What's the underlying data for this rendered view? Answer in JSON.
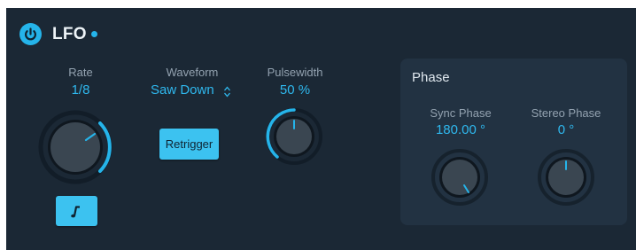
{
  "header": {
    "title": "LFO",
    "power_icon": "power-icon"
  },
  "rate": {
    "label": "Rate",
    "value": "1/8",
    "sync_icon": "note-icon"
  },
  "waveform": {
    "label": "Waveform",
    "value": "Saw Down",
    "stepper_icon": "up-down-chevron-icon",
    "retrigger_label": "Retrigger"
  },
  "pulsewidth": {
    "label": "Pulsewidth",
    "value": "50 %"
  },
  "phase": {
    "title": "Phase",
    "sync": {
      "label": "Sync Phase",
      "value": "180.00 °"
    },
    "stereo": {
      "label": "Stereo Phase",
      "value": "0 °"
    }
  },
  "colors": {
    "accent": "#2fb8ee",
    "panel": "#1b2835",
    "subpanel": "#223242"
  }
}
